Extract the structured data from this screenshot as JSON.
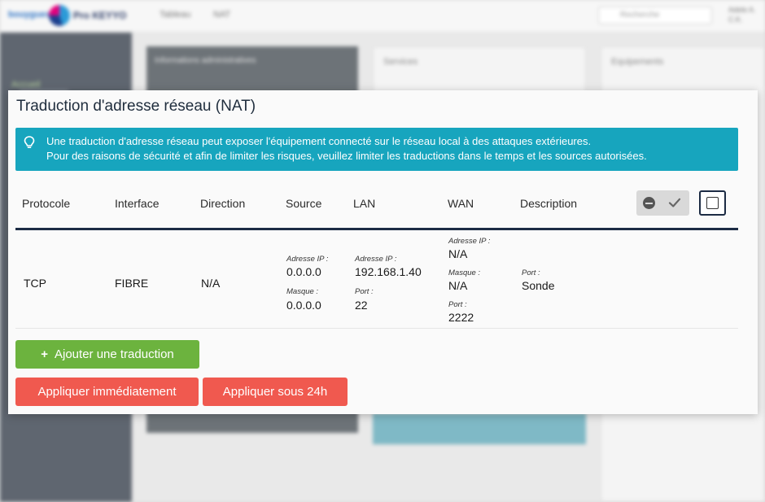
{
  "background": {
    "brand_left": "bouygues",
    "brand_right": "Pro KEYYO",
    "topbar_items": [
      "Tableau",
      "NAT"
    ],
    "search_placeholder": "Recherche",
    "user": [
      "Adele A.",
      "C.K."
    ],
    "sidebar_active": "Accueil",
    "card_titles": [
      "Informations administratives",
      "Services",
      "Equipements"
    ]
  },
  "modal": {
    "title": "Traduction d'adresse réseau (NAT)",
    "alert": {
      "icon": "lightbulb-icon",
      "line1": "Une traduction d'adresse réseau peut exposer l'équipement connecté sur le réseau local à des attaques extérieures.",
      "line2": "Pour des raisons de sécurité et afin de limiter les risques, veuillez limiter les traductions dans le temps et les sources autorisées."
    },
    "table": {
      "headers": {
        "protocole": "Protocole",
        "interface": "Interface",
        "direction": "Direction",
        "source": "Source",
        "lan": "LAN",
        "wan": "WAN",
        "description": "Description"
      },
      "bulk_actions": [
        "minus-circle-icon",
        "check-icon",
        "checkbox-icon"
      ],
      "rows": [
        {
          "protocole": "TCP",
          "interface": "FIBRE",
          "direction": "N/A",
          "source": {
            "ip_label": "Adresse IP :",
            "ip": "0.0.0.0",
            "mask_label": "Masque :",
            "mask": "0.0.0.0"
          },
          "lan": {
            "ip_label": "Adresse IP :",
            "ip": "192.168.1.40",
            "port_label": "Port :",
            "port": "22"
          },
          "wan": {
            "ip_label": "Adresse IP :",
            "ip": "N/A",
            "mask_label": "Masque :",
            "mask": "N/A",
            "port_label": "Port :",
            "port": "2222"
          },
          "description": {
            "port_label": "Port :",
            "port": "Sonde"
          }
        }
      ]
    },
    "buttons": {
      "add": "Ajouter une traduction",
      "apply_now": "Appliquer immédiatement",
      "apply_24h": "Appliquer sous 24h"
    }
  },
  "colors": {
    "alert_bg": "#17a5be",
    "header_rule": "#1c2b44",
    "add_button": "#6cb33e",
    "apply_buttons": "#f0594f"
  }
}
